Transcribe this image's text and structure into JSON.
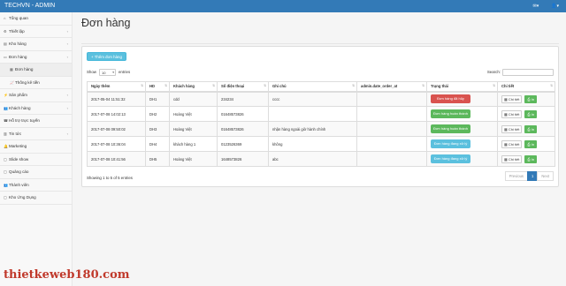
{
  "app": {
    "brand": "TECHVN - ADMIN",
    "top_envelope": "✉▾",
    "top_user": "👤▾"
  },
  "sidebar": {
    "items": [
      {
        "icon": "⌂",
        "label": "Tổng quan",
        "arrow": ""
      },
      {
        "icon": "⚙",
        "label": "Thiết lập",
        "arrow": "‹"
      },
      {
        "icon": "▤",
        "label": "Kho hàng",
        "arrow": "‹"
      },
      {
        "icon": "▭",
        "label": "Đơn hàng",
        "arrow": "‹"
      },
      {
        "icon": "▦",
        "label": "Đơn hàng",
        "arrow": ""
      },
      {
        "icon": "📈",
        "label": "Thống kê tiền",
        "arrow": ""
      },
      {
        "icon": "⚡",
        "label": "Sản phẩm",
        "arrow": "‹"
      },
      {
        "icon": "👥",
        "label": "Khách hàng",
        "arrow": "‹"
      },
      {
        "icon": "☎",
        "label": "Hỗ trợ trực tuyến",
        "arrow": ""
      },
      {
        "icon": "▥",
        "label": "Tin tức",
        "arrow": "‹"
      },
      {
        "icon": "🔔",
        "label": "Marketing",
        "arrow": ""
      },
      {
        "icon": "▢",
        "label": "Slide show",
        "arrow": ""
      },
      {
        "icon": "▢",
        "label": "Quảng cáo",
        "arrow": ""
      },
      {
        "icon": "👥",
        "label": "Thành viên",
        "arrow": ""
      },
      {
        "icon": "▢",
        "label": "Kho Ứng Dụng",
        "arrow": ""
      }
    ]
  },
  "main": {
    "title": "Đơn hàng",
    "add_button": "+ Thêm đơn hàng",
    "show_label": "Show",
    "show_value": "10",
    "entries_label": "entries",
    "search_label": "Search:",
    "search_value": "",
    "columns": [
      "Ngày thêm",
      "HD",
      "Khách hàng",
      "Số điện thoại",
      "Ghi chú",
      "admin.date_order_at",
      "Trạng thái",
      "Chi tiết"
    ],
    "rows": [
      {
        "date": "2017-05-04 11:51:32",
        "hd": "DH1",
        "customer": "cdd",
        "phone": "234234",
        "note": "cccc",
        "admin_date": "",
        "status": "Đơn hàng đã hủy",
        "status_color": "#d9534f"
      },
      {
        "date": "2017-07-08 14:02:13",
        "hd": "DH2",
        "customer": "Hoàng Việt",
        "phone": "01648573826",
        "note": "",
        "admin_date": "",
        "status": "Đơn hàng hoàn thành",
        "status_color": "#5cb85c"
      },
      {
        "date": "2017-07-08 09:50:02",
        "hd": "DH3",
        "customer": "Hoàng Việt",
        "phone": "01648573826",
        "note": "nhận hàng ngoài giờ hành chính",
        "admin_date": "",
        "status": "Đơn hàng hoàn thành",
        "status_color": "#5cb85c"
      },
      {
        "date": "2017-07-08 10:36:04",
        "hd": "DH4",
        "customer": "khách hàng 1",
        "phone": "0123526369",
        "note": "không",
        "admin_date": "",
        "status": "Đơn hàng đang xử lý",
        "status_color": "#5bc0de"
      },
      {
        "date": "2017-07-08 10:41:56",
        "hd": "DH5",
        "customer": "Hoàng Việt",
        "phone": "1648573826",
        "note": "abc",
        "admin_date": "",
        "status": "Đơn hàng đang xử lý",
        "status_color": "#5bc0de"
      }
    ],
    "detail_label": "▦ Chi tiết",
    "print_label": "⎙ In",
    "info": "Showing 1 to 5 of 5 entries",
    "pager": {
      "prev": "Previous",
      "page": "1",
      "next": "Next"
    }
  },
  "watermark": "thietkeweb180.com"
}
